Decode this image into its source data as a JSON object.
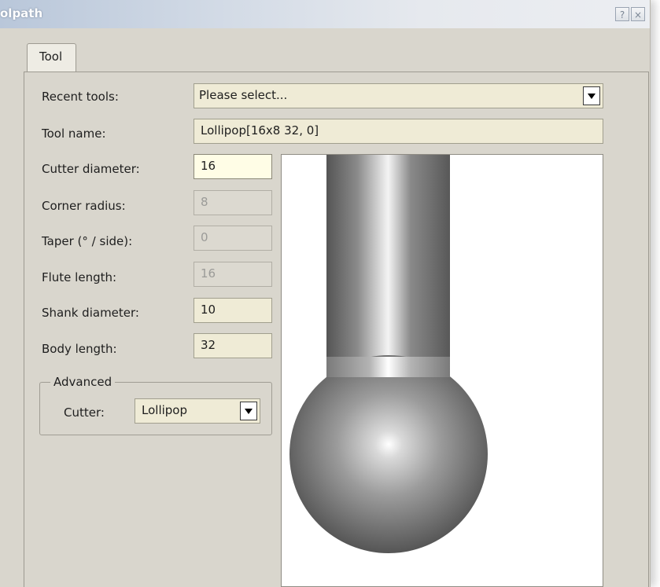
{
  "window": {
    "title": "olpath",
    "help_button": "?",
    "close_button": "×"
  },
  "tabs": [
    {
      "label": "Tool",
      "active": true
    }
  ],
  "form": {
    "recent_tools": {
      "label": "Recent tools:",
      "value": "Please select..."
    },
    "tool_name": {
      "label": "Tool name:",
      "value": "Lollipop[16x8 32, 0]"
    },
    "cutter_diameter": {
      "label": "Cutter diameter:",
      "value": "16"
    },
    "corner_radius": {
      "label": "Corner radius:",
      "value": "8",
      "disabled": true
    },
    "taper": {
      "label": "Taper (° / side):",
      "value": "0",
      "disabled": true
    },
    "flute_length": {
      "label": "Flute length:",
      "value": "16",
      "disabled": true
    },
    "shank_diameter": {
      "label": "Shank diameter:",
      "value": "10"
    },
    "body_length": {
      "label": "Body length:",
      "value": "32"
    }
  },
  "advanced": {
    "group_label": "Advanced",
    "cutter_label": "Cutter:",
    "cutter_value": "Lollipop"
  },
  "preview": {
    "tool_shape": "lollipop-cutter",
    "colors": {
      "shank_dark": "#5e5e5e",
      "shank_highlight": "#f2f2f2",
      "ball_dark": "#4a4a4a",
      "ball_highlight": "#ffffff"
    }
  }
}
